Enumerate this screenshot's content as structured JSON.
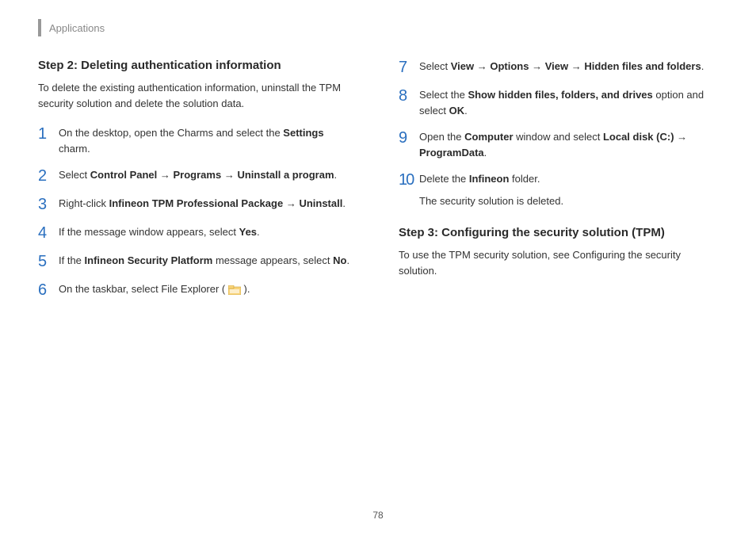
{
  "header": {
    "section": "Applications"
  },
  "page_number": "78",
  "left": {
    "step_title": "Step 2: Deleting authentication information",
    "step_intro": "To delete the existing authentication information, uninstall the TPM security solution and delete the solution data.",
    "items": {
      "n1": "1",
      "t1a": "On the desktop, open the Charms and select the ",
      "t1b": "Settings",
      "t1c": " charm.",
      "n2": "2",
      "t2a": "Select ",
      "t2b": "Control Panel",
      "t2c": "Programs",
      "t2d": "Uninstall a program",
      "n3": "3",
      "t3a": "Right-click ",
      "t3b": "Infineon TPM Professional Package",
      "t3c": "Uninstall",
      "n4": "4",
      "t4a": "If the message window appears, select ",
      "t4b": "Yes",
      "n5": "5",
      "t5a": "If the ",
      "t5b": "Infineon Security Platform",
      "t5c": " message appears, select ",
      "t5d": "No",
      "n6": "6",
      "t6a": "On the taskbar, select File Explorer ( ",
      "t6b": " )."
    }
  },
  "right": {
    "items": {
      "n7": "7",
      "t7a": "Select ",
      "t7b": "View",
      "t7c": "Options",
      "t7d": "View",
      "t7e": "Hidden files and folders",
      "n8": "8",
      "t8a": "Select the ",
      "t8b": "Show hidden files, folders, and drives",
      "t8c": " option and select ",
      "t8d": "OK",
      "n9": "9",
      "t9a": "Open the ",
      "t9b": "Computer",
      "t9c": " window and select ",
      "t9d": "Local disk (C:)",
      "t9e": "ProgramData",
      "n10": "10",
      "t10a": "Delete the ",
      "t10b": "Infineon",
      "t10c": " folder.",
      "t10sub": "The security solution is deleted."
    },
    "step3_title": "Step 3: Configuring the security solution (TPM)",
    "step3_intro": "To use the TPM security solution, see Configuring the security solution."
  },
  "glyphs": {
    "arrow": " → "
  }
}
